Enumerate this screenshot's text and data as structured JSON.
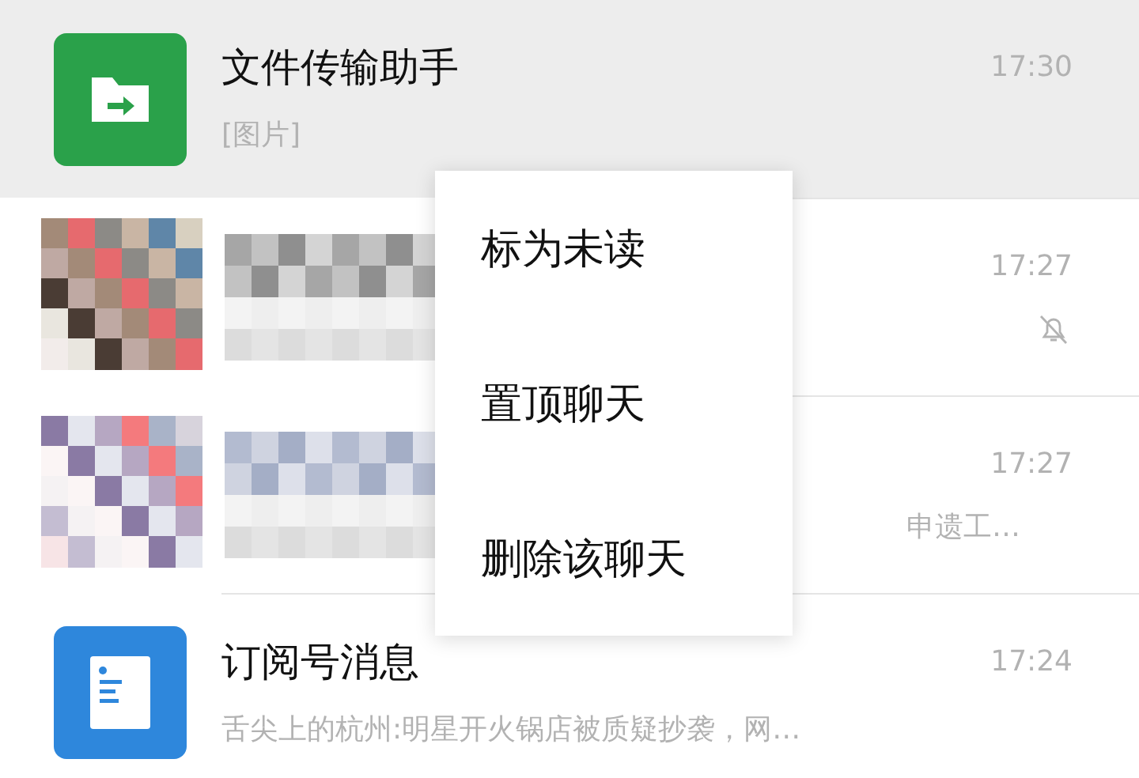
{
  "chats": [
    {
      "kind": "file",
      "selected": true,
      "name": "文件传输助手",
      "preview": "[图片]",
      "time": "17:30",
      "muted": false
    },
    {
      "kind": "picture",
      "selected": false,
      "time": "17:27",
      "muted": true
    },
    {
      "kind": "picture",
      "selected": false,
      "preview": "申遗工…",
      "time": "17:27",
      "muted": false
    },
    {
      "kind": "doc",
      "selected": false,
      "name": "订阅号消息",
      "preview": "舌尖上的杭州:明星开火锅店被质疑抄袭，网…",
      "time": "17:24",
      "muted": false
    }
  ],
  "context_menu": {
    "items": [
      "标为未读",
      "置顶聊天",
      "删除该聊天"
    ]
  }
}
